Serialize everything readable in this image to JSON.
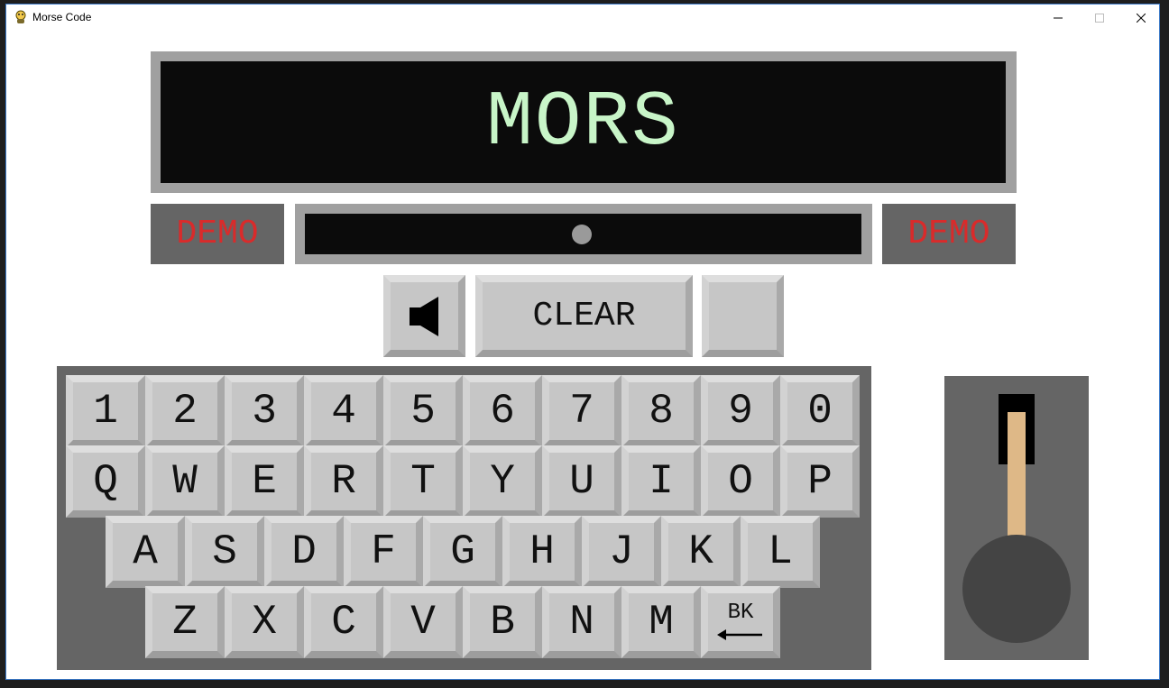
{
  "window": {
    "title": "Morse Code"
  },
  "display": {
    "text": "MORS"
  },
  "demo": {
    "left_label": "DEMO",
    "right_label": "DEMO"
  },
  "controls": {
    "clear_label": "CLEAR",
    "sound_icon": "speaker-icon"
  },
  "keyboard": {
    "rows": [
      [
        "1",
        "2",
        "3",
        "4",
        "5",
        "6",
        "7",
        "8",
        "9",
        "0"
      ],
      [
        "Q",
        "W",
        "E",
        "R",
        "T",
        "Y",
        "U",
        "I",
        "O",
        "P"
      ],
      [
        "A",
        "S",
        "D",
        "F",
        "G",
        "H",
        "J",
        "K",
        "L"
      ],
      [
        "Z",
        "X",
        "C",
        "V",
        "B",
        "N",
        "M"
      ]
    ],
    "backspace_label": "BK"
  },
  "colors": {
    "display_text": "#c8f5c8",
    "demo_text": "#d92b2b",
    "panel": "#656565",
    "key_face": "#c6c6c6",
    "lever_rod": "#deb887"
  }
}
